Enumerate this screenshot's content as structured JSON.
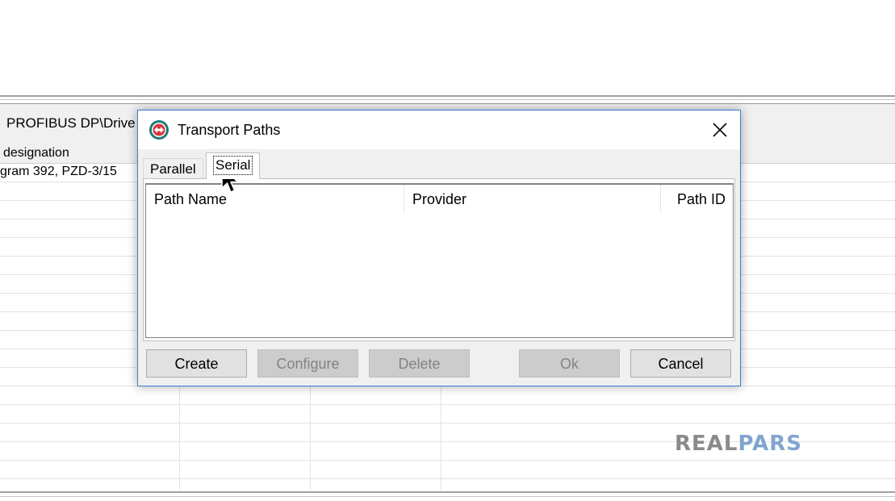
{
  "background_window": {
    "title": "PROFIBUS DP\\Drive",
    "column_header": "designation",
    "rows": [
      "gram 392, PZD-3/15"
    ]
  },
  "dialog": {
    "title": "Transport Paths",
    "icon": "siemens-transport-icon",
    "close_icon": "close-icon",
    "tabs": [
      {
        "label": "Parallel",
        "active": false
      },
      {
        "label": "Serial",
        "active": true
      }
    ],
    "columns": [
      "Path Name",
      "Provider",
      "Path ID"
    ],
    "rows": [],
    "buttons": {
      "create": "Create",
      "configure": "Configure",
      "delete": "Delete",
      "ok": "Ok",
      "cancel": "Cancel"
    },
    "disabled_buttons": [
      "Configure",
      "Delete",
      "Ok"
    ]
  },
  "watermark": {
    "part1": "REAL",
    "part2": "PARS"
  },
  "colors": {
    "dialog_border": "#3b7dd8",
    "icon_ring": "#1f7a7a",
    "watermark_gray": "#8a8a8a",
    "watermark_blue": "#7fa6cf"
  }
}
